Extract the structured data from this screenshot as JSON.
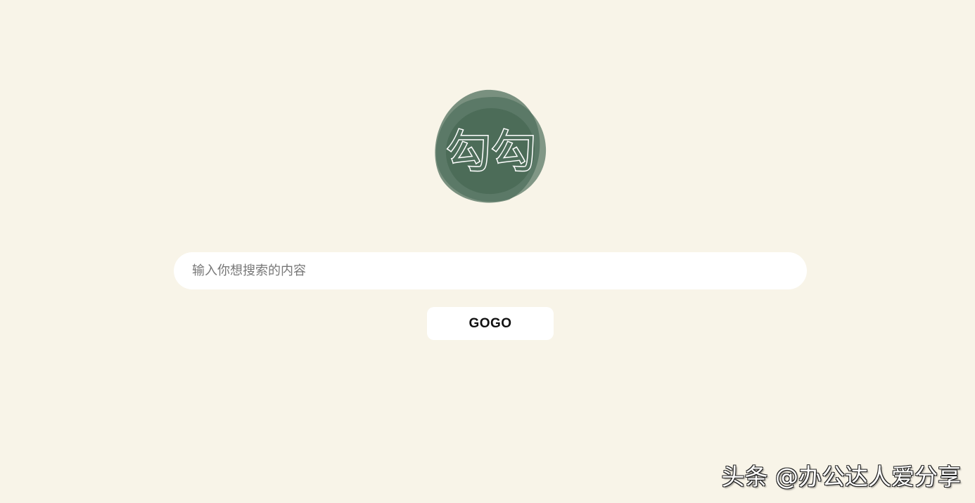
{
  "logo": {
    "text": "勾勾",
    "colors": {
      "blob": "#4f6f5c",
      "text_fill": "#4f6f5c",
      "text_stroke": "#ffffff"
    }
  },
  "search": {
    "placeholder": "输入你想搜索的内容",
    "value": ""
  },
  "button": {
    "label": "GOGO"
  },
  "watermark": {
    "text": "头条 @办公达人爱分享"
  },
  "colors": {
    "background": "#f8f4e8",
    "surface": "#ffffff"
  }
}
